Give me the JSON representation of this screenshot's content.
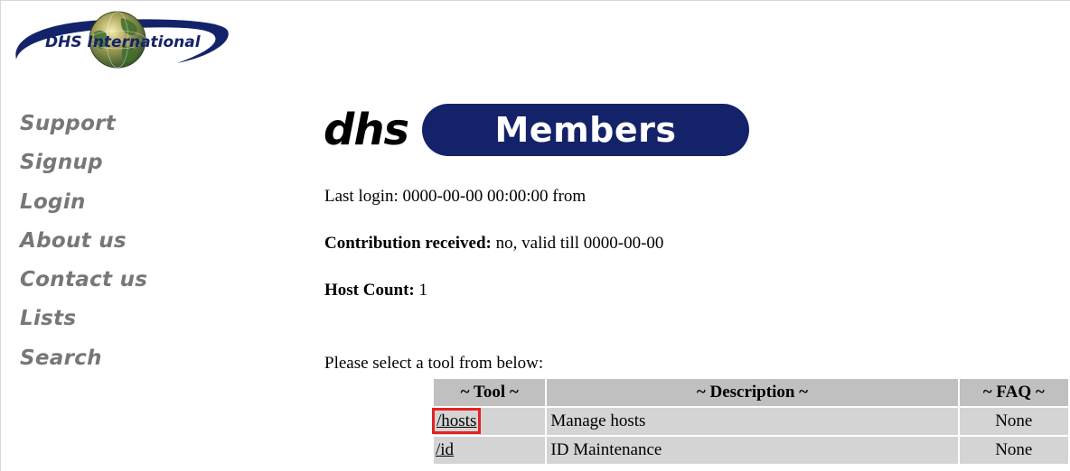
{
  "logo": {
    "text": "DHS International"
  },
  "sidebar": {
    "items": [
      {
        "label": "Support"
      },
      {
        "label": "Signup"
      },
      {
        "label": "Login"
      },
      {
        "label": "About us"
      },
      {
        "label": "Contact us"
      },
      {
        "label": "Lists"
      },
      {
        "label": "Search"
      }
    ]
  },
  "header": {
    "brand": "dhs",
    "title": "Members"
  },
  "info": {
    "last_login": "Last login: 0000-00-00 00:00:00 from",
    "contribution_label": "Contribution received:",
    "contribution_value": " no, valid till 0000-00-00",
    "host_count_label": "Host Count:",
    "host_count_value": " 1",
    "select_prompt": "Please select a tool from below:"
  },
  "tools_table": {
    "headers": {
      "tool": "~ Tool ~",
      "description": "~ Description ~",
      "faq": "~ FAQ ~"
    },
    "rows": [
      {
        "tool": "/hosts",
        "description": "Manage hosts",
        "faq": "None"
      },
      {
        "tool": "/id",
        "description": "ID Maintenance",
        "faq": "None"
      }
    ]
  },
  "colors": {
    "brand_navy": "#142369",
    "nav_gray": "#777777",
    "highlight_red": "#e32222"
  }
}
